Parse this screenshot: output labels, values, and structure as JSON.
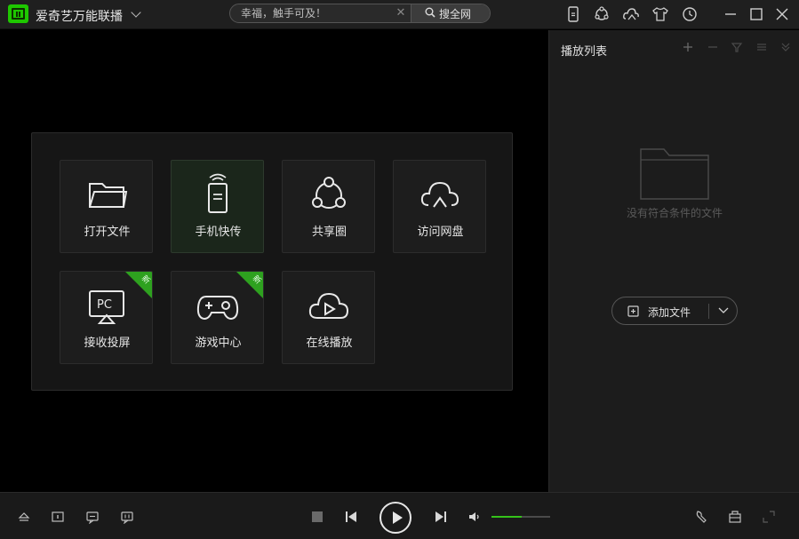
{
  "app": {
    "title": "爱奇艺万能联播"
  },
  "search": {
    "placeholder": "幸福，触手可及！",
    "button_label": "搜全网"
  },
  "tiles": [
    {
      "label": "打开文件",
      "icon": "folder-icon",
      "badge": ""
    },
    {
      "label": "手机快传",
      "icon": "phone-transfer-icon",
      "badge": ""
    },
    {
      "label": "共享圈",
      "icon": "share-circle-icon",
      "badge": ""
    },
    {
      "label": "访问网盘",
      "icon": "cloud-drive-icon",
      "badge": ""
    },
    {
      "label": "接收投屏",
      "icon": "pc-screen-cast-icon",
      "badge": "新"
    },
    {
      "label": "游戏中心",
      "icon": "gamepad-icon",
      "badge": "新"
    },
    {
      "label": "在线播放",
      "icon": "cloud-play-icon",
      "badge": ""
    }
  ],
  "playlist": {
    "title": "播放列表",
    "empty_text": "没有符合条件的文件",
    "add_button_label": "添加文件"
  },
  "player": {
    "volume_percent": 52
  },
  "colors": {
    "accent": "#2ea11f",
    "background": "#000000",
    "sidebar": "#1c1c1c"
  }
}
